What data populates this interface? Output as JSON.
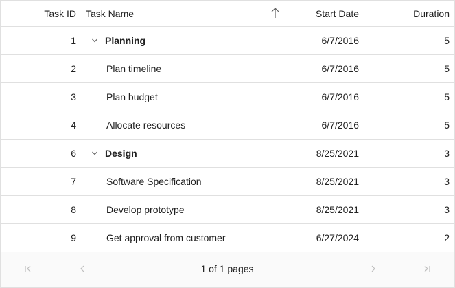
{
  "columns": {
    "task_id": "Task ID",
    "task_name": "Task Name",
    "start_date": "Start Date",
    "duration": "Duration",
    "sort_icon": "arrow-up-icon"
  },
  "rows": [
    {
      "id": "1",
      "name": "Planning",
      "start": "6/7/2016",
      "duration": "5",
      "type": "parent",
      "expanded": true
    },
    {
      "id": "2",
      "name": "Plan timeline",
      "start": "6/7/2016",
      "duration": "5",
      "type": "child"
    },
    {
      "id": "3",
      "name": "Plan budget",
      "start": "6/7/2016",
      "duration": "5",
      "type": "child"
    },
    {
      "id": "4",
      "name": "Allocate resources",
      "start": "6/7/2016",
      "duration": "5",
      "type": "child"
    },
    {
      "id": "6",
      "name": "Design",
      "start": "8/25/2021",
      "duration": "3",
      "type": "parent",
      "expanded": true
    },
    {
      "id": "7",
      "name": "Software Specification",
      "start": "8/25/2021",
      "duration": "3",
      "type": "child"
    },
    {
      "id": "8",
      "name": "Develop prototype",
      "start": "8/25/2021",
      "duration": "3",
      "type": "child"
    },
    {
      "id": "9",
      "name": "Get approval from customer",
      "start": "6/27/2024",
      "duration": "2",
      "type": "child"
    }
  ],
  "pager": {
    "info": "1 of 1 pages",
    "icons": [
      "first-page-icon",
      "previous-page-icon",
      "next-page-icon",
      "last-page-icon"
    ]
  },
  "colors": {
    "border": "#e0e0e0",
    "text": "#212121",
    "icon_disabled": "#bdbdbd",
    "pager_bg": "#fafafa"
  }
}
